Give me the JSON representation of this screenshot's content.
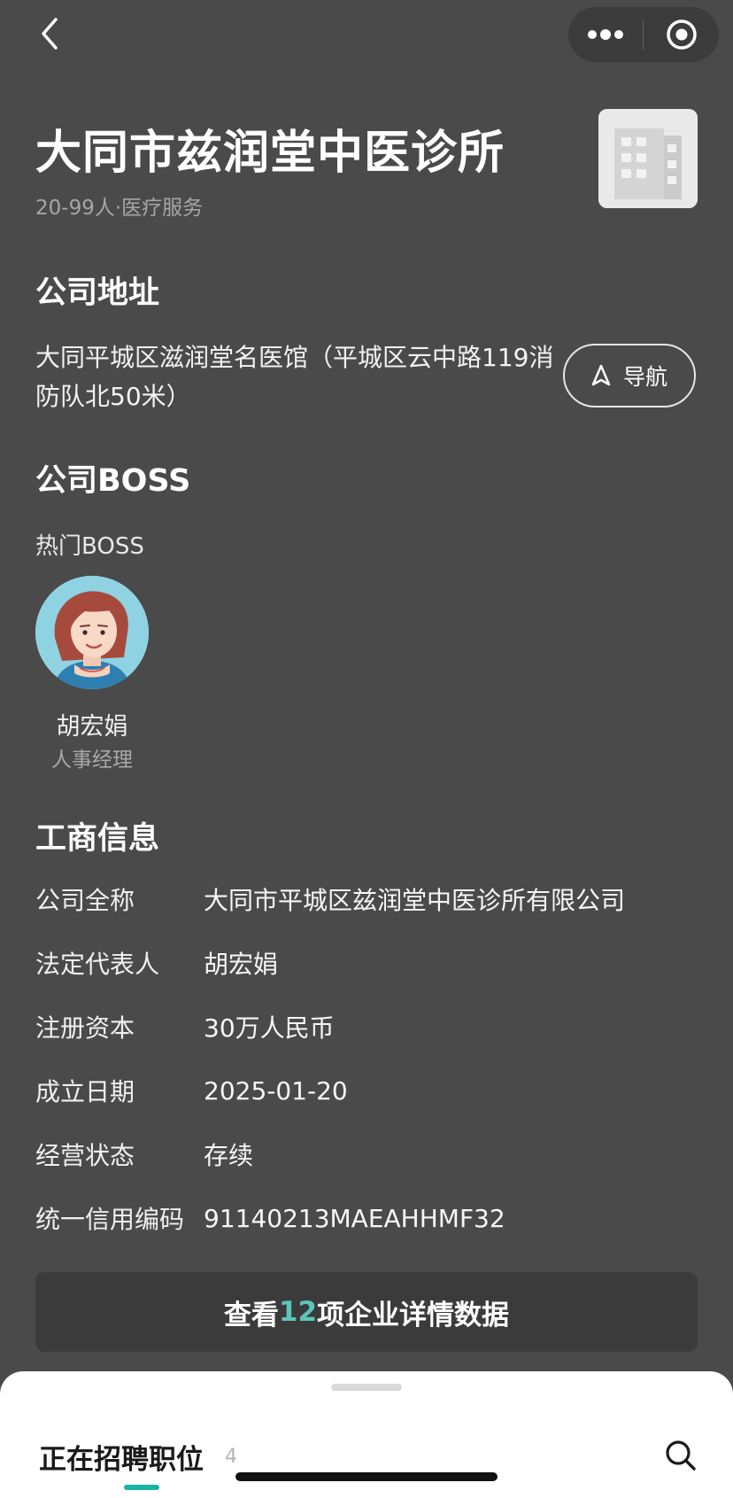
{
  "company": {
    "name": "大同市兹润堂中医诊所",
    "meta": "20-99人·医疗服务"
  },
  "address": {
    "heading": "公司地址",
    "text": "大同平城区滋润堂名医馆（平城区云中路119消防队北50米）",
    "nav_label": "导航"
  },
  "boss": {
    "heading": "公司BOSS",
    "hot_label": "热门BOSS",
    "people": [
      {
        "name": "胡宏娟",
        "role": "人事经理"
      }
    ]
  },
  "business_info": {
    "heading": "工商信息",
    "rows": [
      {
        "key": "公司全称",
        "value": "大同市平城区兹润堂中医诊所有限公司"
      },
      {
        "key": "法定代表人",
        "value": "胡宏娟"
      },
      {
        "key": "注册资本",
        "value": "30万人民币"
      },
      {
        "key": "成立日期",
        "value": "2025-01-20"
      },
      {
        "key": "经营状态",
        "value": "存续"
      },
      {
        "key": "统一信用编码",
        "value": "91140213MAEAHHMF32"
      }
    ]
  },
  "detail_button": {
    "prefix": "查看",
    "count": "12",
    "suffix": "项企业详情数据"
  },
  "bottom_sheet": {
    "tab_label": "正在招聘职位",
    "tab_count": "4"
  },
  "colors": {
    "background": "#4a4a4a",
    "accent": "#5cc6b8",
    "tab_indicator": "#17b3a3"
  },
  "icons": {
    "back": "chevron-left-icon",
    "more": "more-dots-icon",
    "close": "target-circle-icon",
    "logo": "building-icon",
    "navigate": "navigation-arrow-icon",
    "search": "search-icon"
  }
}
